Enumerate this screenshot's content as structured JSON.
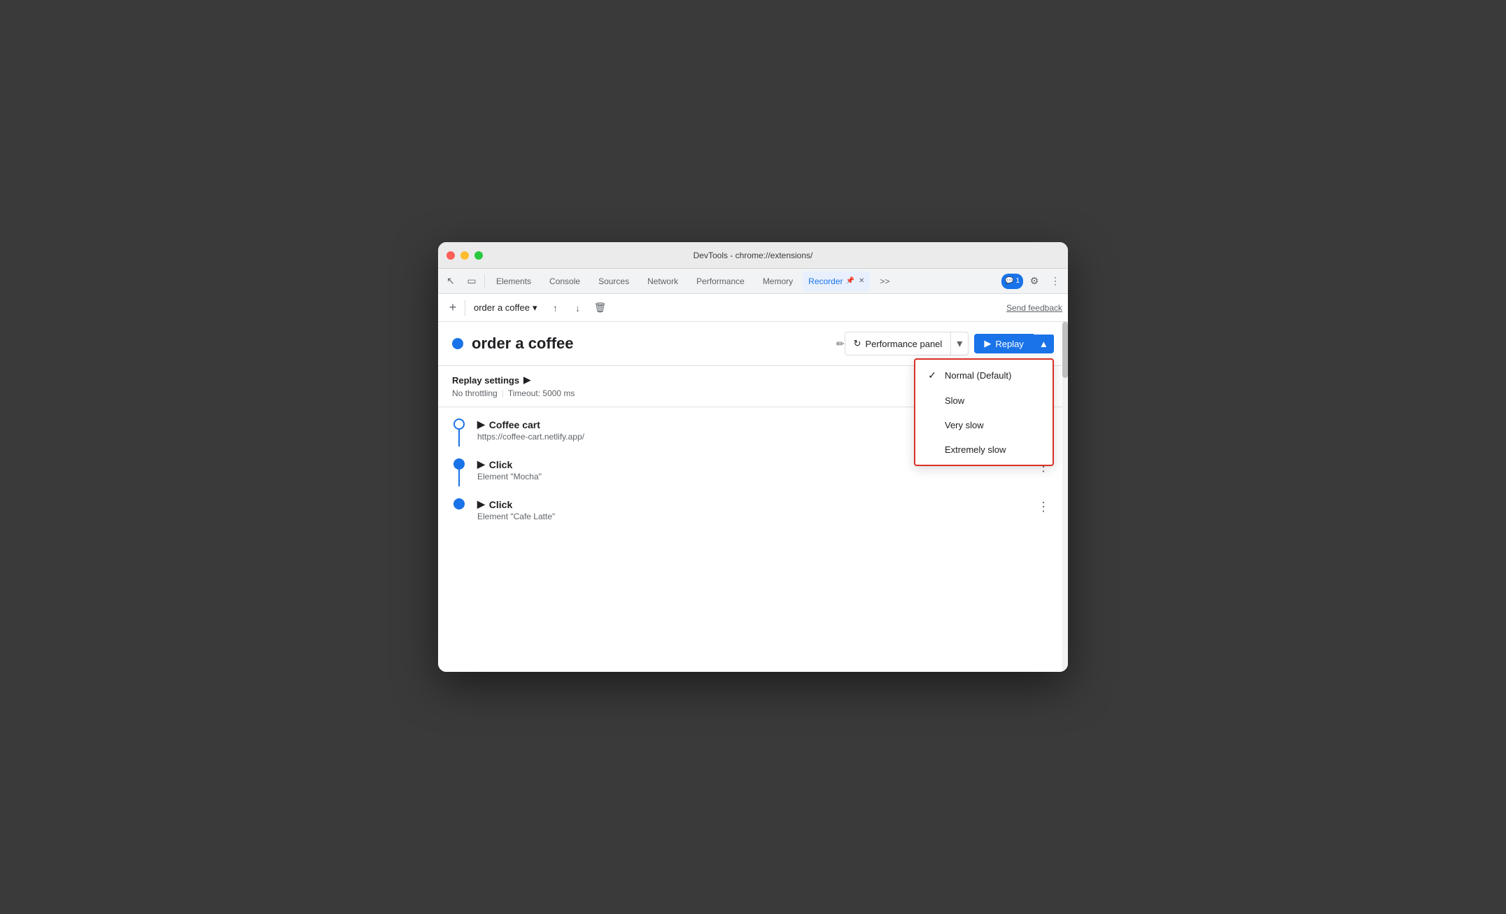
{
  "window": {
    "title": "DevTools - chrome://extensions/"
  },
  "tabs": {
    "items": [
      {
        "label": "Elements",
        "active": false
      },
      {
        "label": "Console",
        "active": false
      },
      {
        "label": "Sources",
        "active": false
      },
      {
        "label": "Network",
        "active": false
      },
      {
        "label": "Performance",
        "active": false
      },
      {
        "label": "Memory",
        "active": false
      },
      {
        "label": "Recorder",
        "active": true
      }
    ],
    "more_label": ">>",
    "chat_count": "1"
  },
  "toolbar": {
    "add_label": "+",
    "recording_name": "order a coffee",
    "send_feedback": "Send feedback"
  },
  "recording": {
    "title": "order a coffee",
    "perf_panel_label": "Performance panel",
    "replay_label": "Replay",
    "dropdown": {
      "options": [
        {
          "label": "Normal (Default)",
          "checked": true
        },
        {
          "label": "Slow",
          "checked": false
        },
        {
          "label": "Very slow",
          "checked": false
        },
        {
          "label": "Extremely slow",
          "checked": false
        }
      ]
    }
  },
  "settings": {
    "title": "Replay settings",
    "no_throttling": "No throttling",
    "timeout": "Timeout: 5000 ms"
  },
  "steps": [
    {
      "type": "navigate",
      "title": "Coffee cart",
      "url": "https://coffee-cart.netlify.app/"
    },
    {
      "type": "click",
      "title": "Click",
      "subtitle": "Element \"Mocha\""
    },
    {
      "type": "click",
      "title": "Click",
      "subtitle": "Element \"Cafe Latte\""
    }
  ],
  "icons": {
    "cursor": "⬆",
    "square": "⬜",
    "upload": "↑",
    "download": "↓",
    "trash": "🗑",
    "chevron_down": "▾",
    "edit": "✏",
    "play": "▶",
    "arrow_up": "▲",
    "triangle_right": "▶",
    "more_vert": "⋮",
    "pin": "📌",
    "chat": "💬",
    "gear": "⚙",
    "more_horiz": "⋮",
    "refresh": "↻",
    "check": "✓"
  }
}
